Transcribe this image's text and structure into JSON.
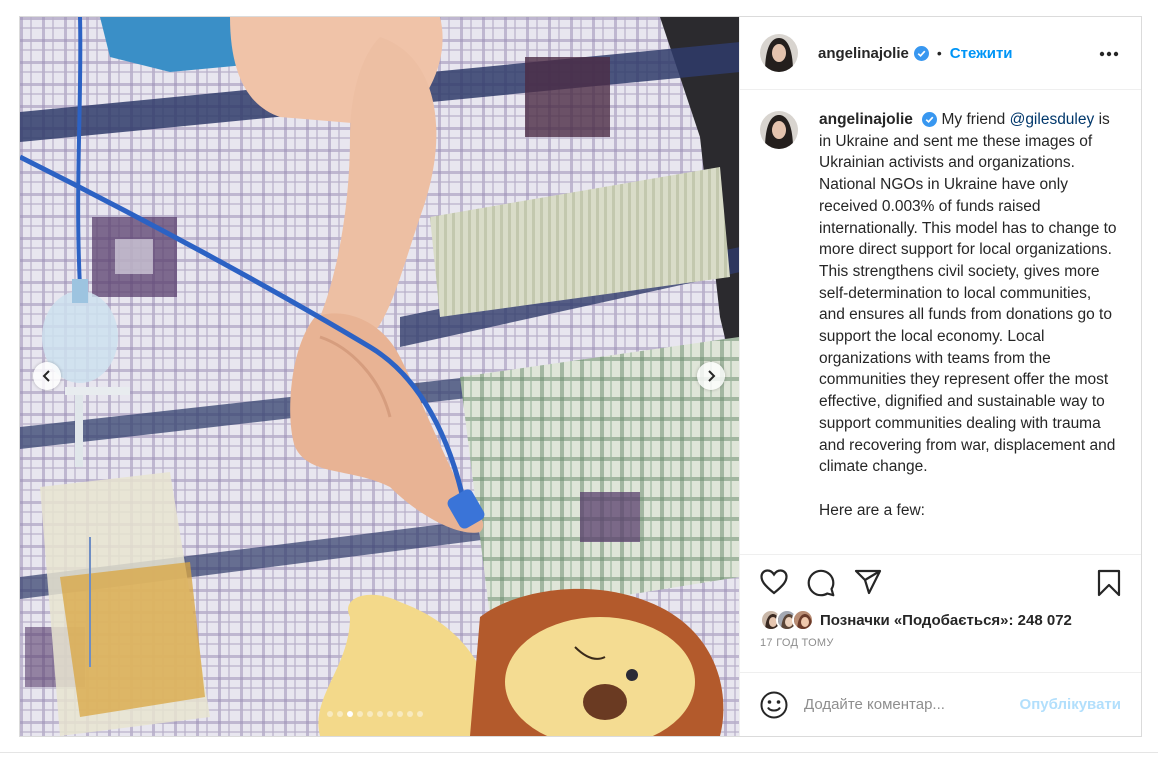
{
  "post": {
    "username": "angelinajolie",
    "verified": true,
    "separator": "•",
    "follow_label": "Стежити",
    "more_icon": "more-horizontal-icon"
  },
  "caption": {
    "username": "angelinajolie",
    "lead": "My friend",
    "mention": "@gilesduley",
    "body": "is in Ukraine and sent me these images of Ukrainian activists and organizations. National NGOs in Ukraine have only received 0.003% of funds raised internationally. This model has to change to more direct support for local organizations. This strengthens civil society, gives more self-determination to local communities, and ensures all funds from donations go to support the local economy. Local organizations with teams from the communities they represent offer the most effective, dignified and sustainable way to support communities dealing with trauma and recovering from war, displacement and climate change.",
    "more_text": "Here are a few:"
  },
  "carousel": {
    "total": 10,
    "active": 2
  },
  "actions": {
    "icons": [
      "heart-icon",
      "comment-icon",
      "share-icon",
      "bookmark-icon"
    ],
    "likes_text": "Позначки «Подобається»: 248 072",
    "time": "17 ГОД ТОМУ"
  },
  "comment": {
    "placeholder": "Додайте коментар...",
    "publish_label": "Опублікувати"
  },
  "colors": {
    "accent": "#0095f6",
    "publish_disabled": "#b2dffc",
    "mention": "#00376b",
    "muted": "#8e8e8e"
  }
}
